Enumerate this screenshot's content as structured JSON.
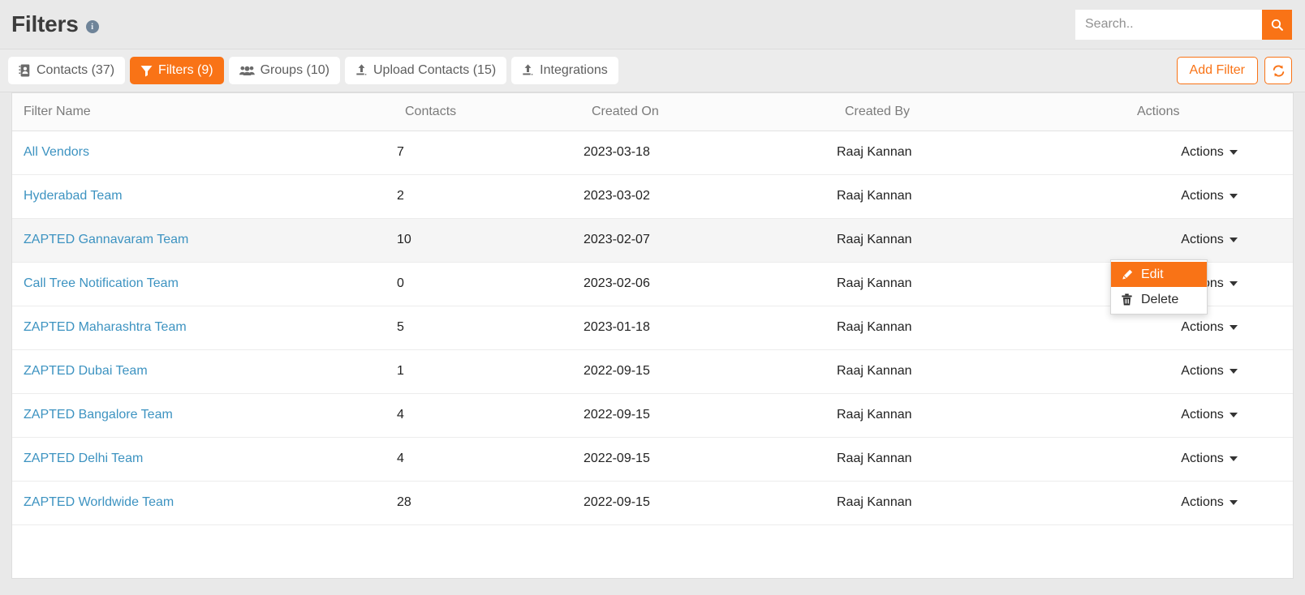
{
  "header": {
    "title": "Filters",
    "info_icon": "info-circle-icon",
    "search": {
      "placeholder": "Search..",
      "value": "",
      "button_icon": "search-icon"
    }
  },
  "tabs": [
    {
      "label": "Contacts (37)",
      "icon": "address-book-icon",
      "active": false
    },
    {
      "label": "Filters (9)",
      "icon": "funnel-icon",
      "active": true
    },
    {
      "label": "Groups (10)",
      "icon": "users-icon",
      "active": false
    },
    {
      "label": "Upload Contacts (15)",
      "icon": "upload-icon",
      "active": false
    },
    {
      "label": "Integrations",
      "icon": "upload-icon",
      "active": false
    }
  ],
  "toolbar": {
    "add_filter_label": "Add Filter",
    "refresh_icon": "refresh-icon"
  },
  "table": {
    "columns": [
      "Filter Name",
      "Contacts",
      "Created On",
      "Created By",
      "Actions"
    ],
    "row_action_label": "Actions",
    "rows": [
      {
        "name": "All Vendors",
        "contacts": "7",
        "created_on": "2023-03-18",
        "created_by": "Raaj Kannan",
        "highlighted": false
      },
      {
        "name": "Hyderabad Team",
        "contacts": "2",
        "created_on": "2023-03-02",
        "created_by": "Raaj Kannan",
        "highlighted": false
      },
      {
        "name": "ZAPTED Gannavaram Team",
        "contacts": "10",
        "created_on": "2023-02-07",
        "created_by": "Raaj Kannan",
        "highlighted": true
      },
      {
        "name": "Call Tree Notification Team",
        "contacts": "0",
        "created_on": "2023-02-06",
        "created_by": "Raaj Kannan",
        "highlighted": false
      },
      {
        "name": "ZAPTED Maharashtra Team",
        "contacts": "5",
        "created_on": "2023-01-18",
        "created_by": "Raaj Kannan",
        "highlighted": false
      },
      {
        "name": "ZAPTED Dubai Team",
        "contacts": "1",
        "created_on": "2022-09-15",
        "created_by": "Raaj Kannan",
        "highlighted": false
      },
      {
        "name": "ZAPTED Bangalore Team",
        "contacts": "4",
        "created_on": "2022-09-15",
        "created_by": "Raaj Kannan",
        "highlighted": false
      },
      {
        "name": "ZAPTED Delhi Team",
        "contacts": "4",
        "created_on": "2022-09-15",
        "created_by": "Raaj Kannan",
        "highlighted": false
      },
      {
        "name": "ZAPTED Worldwide Team",
        "contacts": "28",
        "created_on": "2022-09-15",
        "created_by": "Raaj Kannan",
        "highlighted": false
      }
    ]
  },
  "dropdown": {
    "open_for_row": 2,
    "items": [
      {
        "label": "Edit",
        "icon": "pencil-icon",
        "highlighted": true
      },
      {
        "label": "Delete",
        "icon": "trash-icon",
        "highlighted": false
      }
    ]
  },
  "colors": {
    "accent": "#f97316",
    "link": "#3d93c1",
    "page_bg": "#e9e9e9",
    "row_hover": "#f5f5f5"
  }
}
